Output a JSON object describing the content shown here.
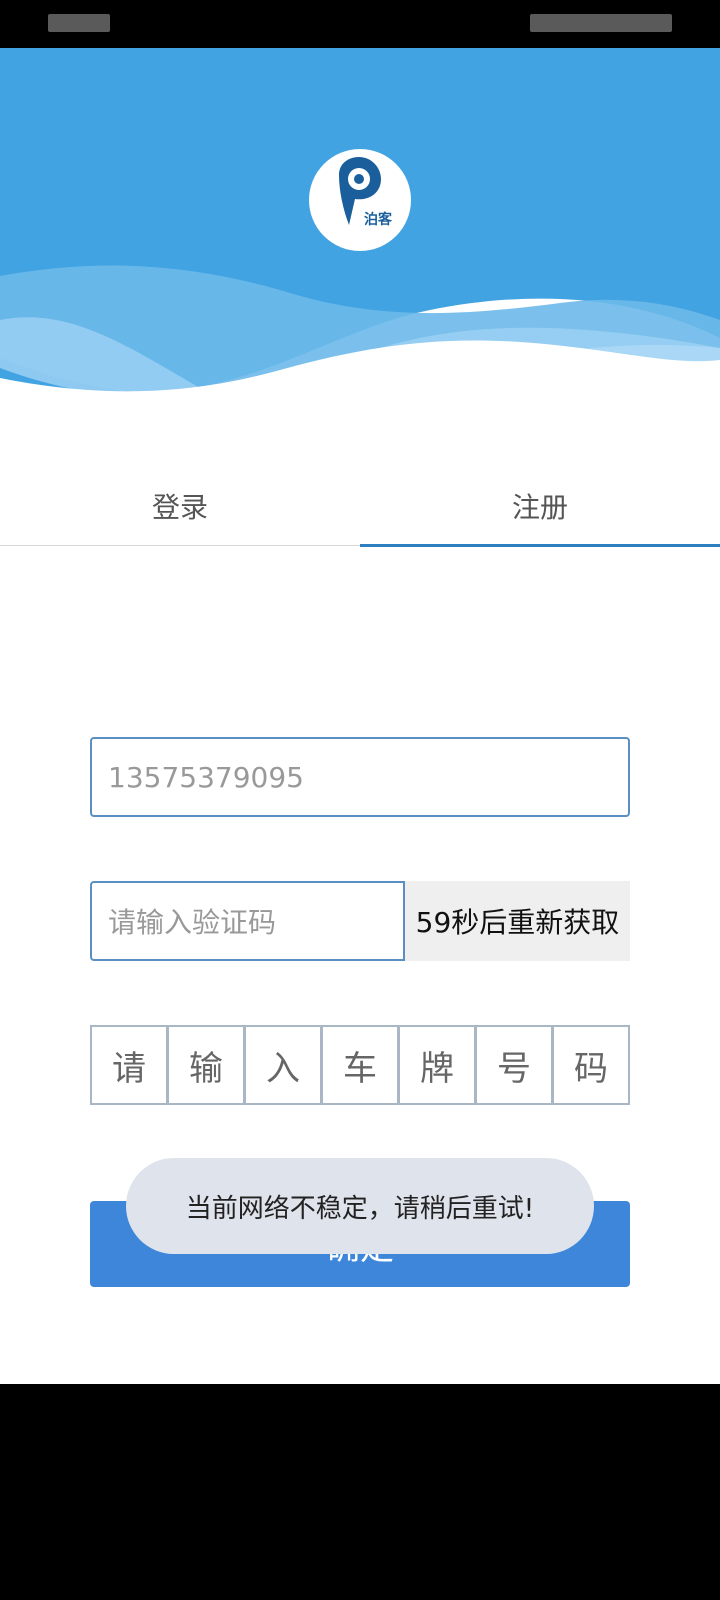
{
  "app": {
    "brand": "泊客"
  },
  "tabs": [
    {
      "label": "登录",
      "active": false
    },
    {
      "label": "注册",
      "active": true
    }
  ],
  "form": {
    "phone_placeholder": "13575379095",
    "code_placeholder": "请输入验证码",
    "resend_label": "59秒后重新获取",
    "plate_chars": [
      "请",
      "输",
      "入",
      "车",
      "牌",
      "号",
      "码"
    ],
    "confirm_label": "确定"
  },
  "toast": {
    "message": "当前网络不稳定，请稍后重试!"
  },
  "colors": {
    "header_blue": "#42a3e2",
    "accent": "#2f7fc0",
    "button_blue": "#3e86d9"
  }
}
